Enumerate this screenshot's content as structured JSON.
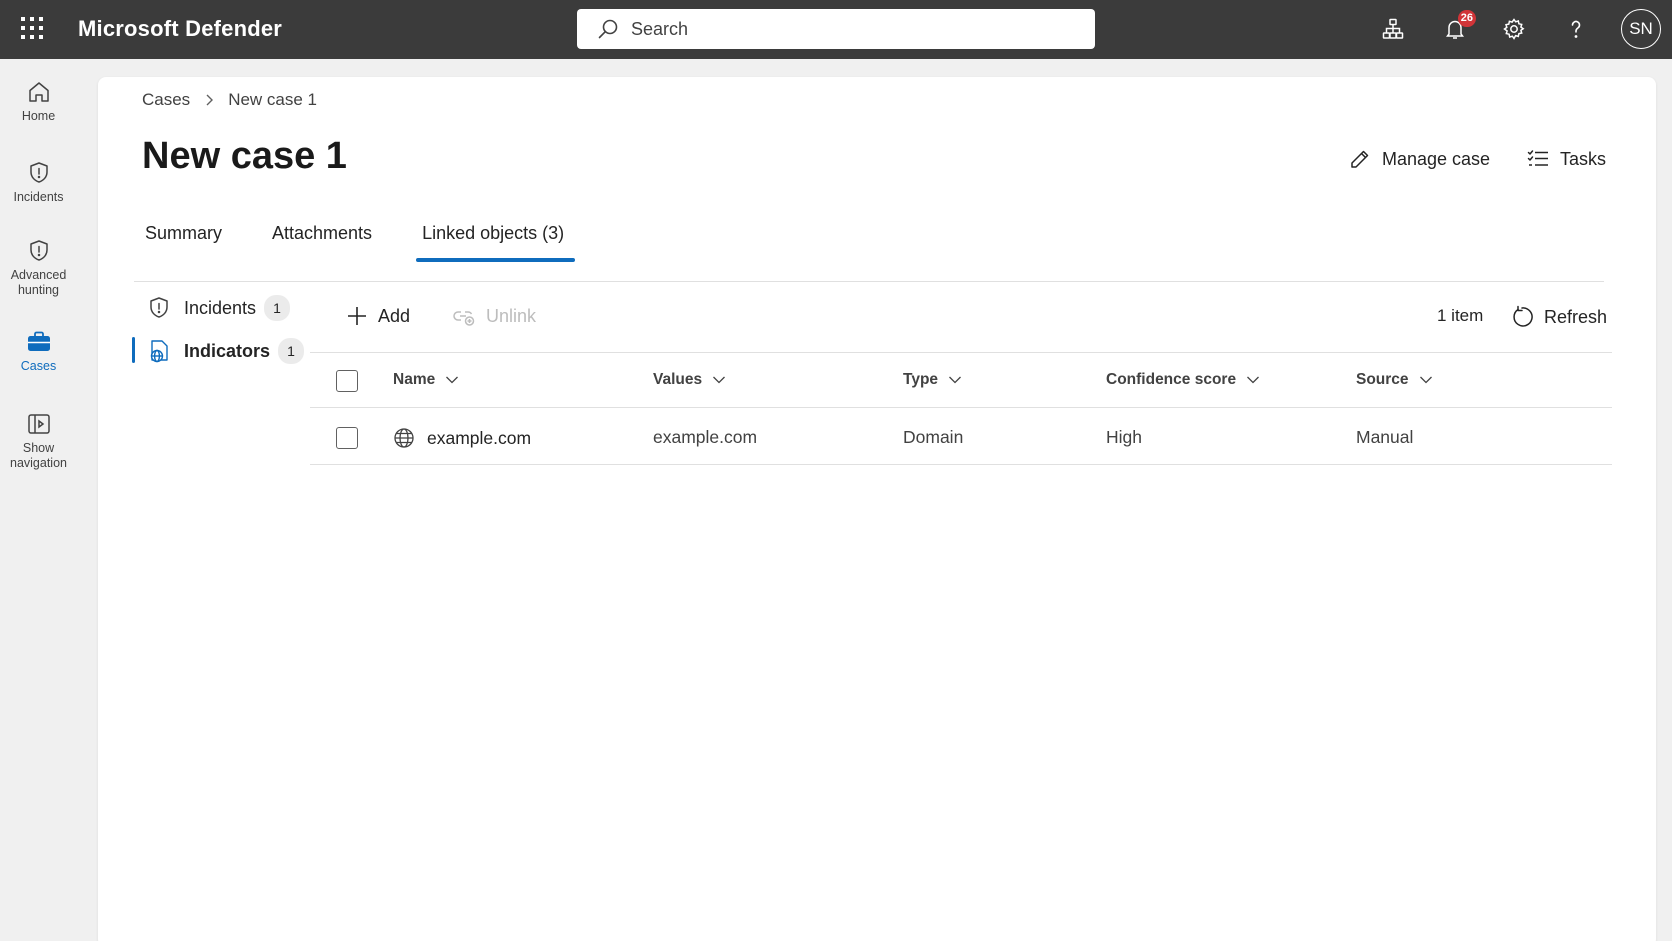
{
  "app": {
    "title": "Microsoft Defender"
  },
  "search": {
    "placeholder": "Search"
  },
  "header": {
    "notifications_count": "26",
    "avatar_initials": "SN"
  },
  "rail": {
    "items": [
      {
        "label": "Home",
        "icon": "home-icon"
      },
      {
        "label": "Incidents",
        "icon": "shield-icon"
      },
      {
        "label": "Advanced hunting",
        "icon": "shield-icon"
      },
      {
        "label": "Cases",
        "icon": "briefcase-icon",
        "active": true
      },
      {
        "label": "Show navigation",
        "icon": "show-navigation-icon"
      }
    ]
  },
  "breadcrumb": {
    "parent": "Cases",
    "current": "New case 1"
  },
  "page": {
    "title": "New case 1"
  },
  "actions": {
    "manage_case": "Manage case",
    "tasks": "Tasks"
  },
  "tabs": [
    {
      "label": "Summary"
    },
    {
      "label": "Attachments"
    },
    {
      "label": "Linked objects (3)",
      "active": true
    }
  ],
  "subnav": [
    {
      "label": "Incidents",
      "count": "1"
    },
    {
      "label": "Indicators",
      "count": "1",
      "active": true
    }
  ],
  "toolbar": {
    "add": "Add",
    "unlink": "Unlink",
    "item_count": "1 item",
    "refresh": "Refresh"
  },
  "table": {
    "columns": [
      "Name",
      "Values",
      "Type",
      "Confidence score",
      "Source"
    ],
    "rows": [
      {
        "name": "example.com",
        "value": "example.com",
        "type": "Domain",
        "confidence": "High",
        "source": "Manual"
      }
    ]
  },
  "colors": {
    "accent": "#0f6cbd",
    "topbar": "#3b3b3b",
    "badge": "#d13438"
  }
}
